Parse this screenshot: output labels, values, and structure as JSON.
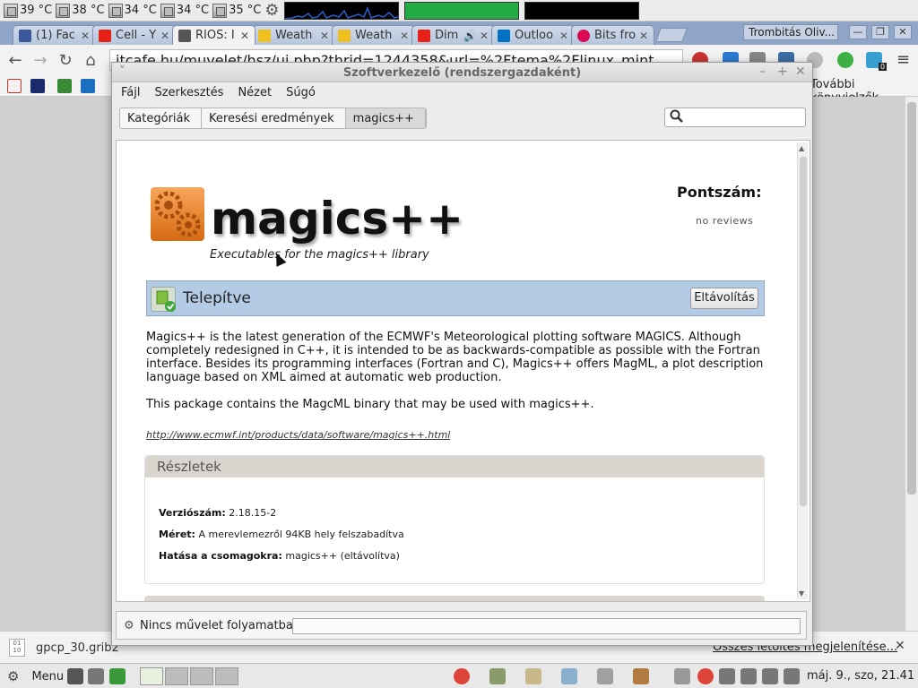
{
  "system_panel": {
    "temps": [
      "39 °C",
      "38 °C",
      "34 °C",
      "34 °C",
      "35 °C"
    ],
    "icons": [
      "chip-icon",
      "gear-icon",
      "network-graph",
      "cpu-graph",
      "mem-graph"
    ],
    "colors": {
      "cpu_graph": "#22aa44",
      "net_graph": "#2a5fd0"
    }
  },
  "browser": {
    "tabs": [
      {
        "label": "(1) Fac",
        "icon": "facebook-icon",
        "color": "#3b5998"
      },
      {
        "label": "Cell - Y",
        "icon": "youtube-icon",
        "color": "#e62117"
      },
      {
        "label": "RIOS: I",
        "icon": "rios-icon",
        "color": "#555555",
        "active": true
      },
      {
        "label": "Weath",
        "icon": "weather-icon",
        "color": "#f0c020"
      },
      {
        "label": "Weath",
        "icon": "weather-icon",
        "color": "#f0c020"
      },
      {
        "label": "Dim",
        "icon": "youtube-icon",
        "color": "#e62117"
      },
      {
        "label": "Outloo",
        "icon": "outlook-icon",
        "color": "#0072c6"
      },
      {
        "label": "Bits fro",
        "icon": "debian-icon",
        "color": "#d70a53"
      }
    ],
    "profile_name": "Trombitás Oliv...",
    "url": "itcafe.hu/muvelet/hsz/uj.php?thrid=1244358&url=%2Ftema%2Flinux_mint",
    "more_bookmarks": "További könyvjelzők",
    "ext_badge": "0"
  },
  "download": {
    "filename": "gpcp_30.grib2",
    "file_icon_text": "01\n10",
    "show_all": "Összes letöltés megjelenítése..."
  },
  "taskbar": {
    "menu": "Menu",
    "clock": "máj.  9., szo, 21.41"
  },
  "software_manager": {
    "title": "Szoftverkezelő (rendszergazdaként)",
    "menus": [
      "Fájl",
      "Szerkesztés",
      "Nézet",
      "Súgó"
    ],
    "breadcrumbs": [
      "Kategóriák",
      "Keresési eredmények",
      "magics++"
    ],
    "search_placeholder": "",
    "package": {
      "name": "magics++",
      "summary": "Executables for the magics++ library",
      "score_label": "Pontszám:",
      "score_value": "no reviews",
      "status": "Telepítve",
      "action": "Eltávolítás",
      "description": "Magics++ is the latest generation of the ECMWF's Meteorological plotting software MAGICS. Although completely redesigned in C++, it is intended to be as backwards-compatible as possible with the Fortran interface. Besides its programming interfaces (Fortran and C), Magics++ offers MagML, a plot description language based on XML aimed at automatic web production.",
      "description2": "This package contains the MagcML binary that may be used with magics++.",
      "homepage": "http://www.ecmwf.int/products/data/software/magics++.html"
    },
    "details": {
      "heading": "Részletek",
      "version_label": "Verziószám:",
      "version": "2.18.15-2",
      "size_label": "Méret:",
      "size": "A merevlemezről 94KB hely felszabadítva",
      "impact_label": "Hatása a csomagokra:",
      "impact": "magics++ (eltávolítva)"
    },
    "status_text": "Nincs művelet folyamatban"
  }
}
